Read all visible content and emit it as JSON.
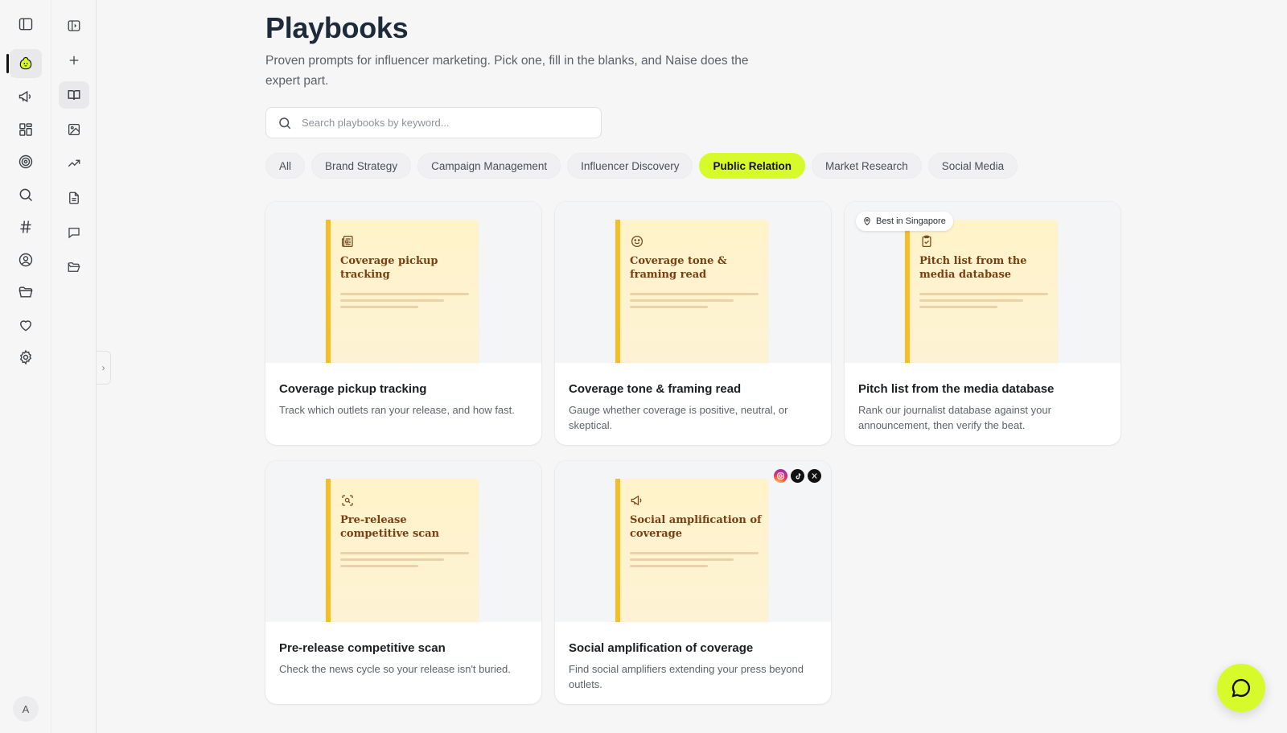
{
  "rail": {
    "items": [
      {
        "name": "sidebar-toggle-icon"
      },
      {
        "name": "naise-home-icon"
      },
      {
        "name": "megaphone-icon"
      },
      {
        "name": "dashboard-icon"
      },
      {
        "name": "target-icon"
      },
      {
        "name": "search-icon"
      },
      {
        "name": "hashtag-icon"
      },
      {
        "name": "profile-icon"
      },
      {
        "name": "folder-icon"
      },
      {
        "name": "heart-icon"
      },
      {
        "name": "settings-icon"
      }
    ],
    "avatar_initial": "A"
  },
  "subnav": {
    "items": [
      {
        "name": "expand-panel-icon"
      },
      {
        "name": "plus-icon"
      },
      {
        "name": "playbook-book-icon"
      },
      {
        "name": "image-icon"
      },
      {
        "name": "trending-icon"
      },
      {
        "name": "document-icon"
      },
      {
        "name": "chat-icon"
      },
      {
        "name": "folder-open-icon"
      }
    ]
  },
  "page": {
    "title": "Playbooks",
    "subtitle": "Proven prompts for influencer marketing. Pick one, fill in the blanks, and Naise does the expert part."
  },
  "search": {
    "placeholder": "Search playbooks by keyword..."
  },
  "filters": {
    "active": "Public Relation",
    "items": [
      "All",
      "Brand Strategy",
      "Campaign Management",
      "Influencer Discovery",
      "Public Relation",
      "Market Research",
      "Social Media"
    ]
  },
  "cards": [
    {
      "cover_title": "Coverage pickup tracking",
      "title": "Coverage pickup tracking",
      "description": "Track which outlets ran your release, and how fast.",
      "icon": "newspaper-icon"
    },
    {
      "cover_title": "Coverage tone & framing read",
      "title": "Coverage tone & framing read",
      "description": "Gauge whether coverage is positive, neutral, or skeptical.",
      "icon": "smile-icon"
    },
    {
      "cover_title": "Pitch list from the media database",
      "title": "Pitch list from the media database",
      "description": "Rank our journalist database against your announcement, then verify the beat.",
      "icon": "clipboard-check-icon",
      "badge": "Best in Singapore"
    },
    {
      "cover_title": "Pre-release competitive scan",
      "title": "Pre-release competitive scan",
      "description": "Check the news cycle so your release isn't buried.",
      "icon": "scan-search-icon"
    },
    {
      "cover_title": "Social amplification of coverage",
      "title": "Social amplification of coverage",
      "description": "Find social amplifiers extending your press beyond outlets.",
      "icon": "megaphone-icon",
      "socials": [
        "instagram-icon",
        "tiktok-icon",
        "x-icon"
      ]
    }
  ],
  "colors": {
    "accent": "#d7fa2a",
    "spine": "#f3bf26",
    "cover": "#fff3c9",
    "cover_title": "#7a3e12"
  }
}
